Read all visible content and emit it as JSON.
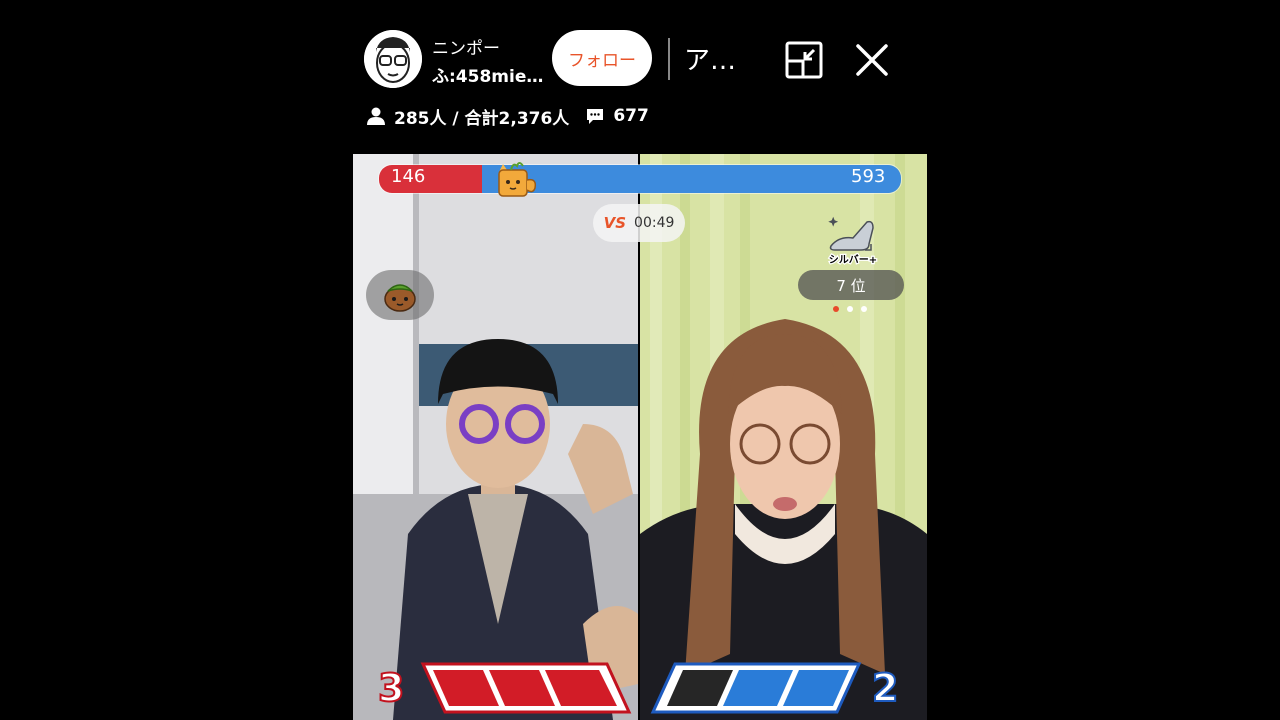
{
  "header": {
    "streamer_name": "ニンポー",
    "streamer_sub": "ふ:458mie…",
    "follow_label": "フォロー",
    "more_text": "ア…"
  },
  "stats": {
    "viewers": "285人 / 合計2,376人",
    "comments": "677"
  },
  "battle": {
    "left_score": "146",
    "right_score": "593",
    "vs_label": "VS",
    "timer": "00:49",
    "left_score_share": 0.198,
    "rank_badge_label": "シルバー+",
    "rank": "7 位",
    "left_wins": "3",
    "right_wins": "2"
  },
  "colors": {
    "red": "#d9303a",
    "blue": "#3d8bdd",
    "follow_text": "#e8542a"
  }
}
